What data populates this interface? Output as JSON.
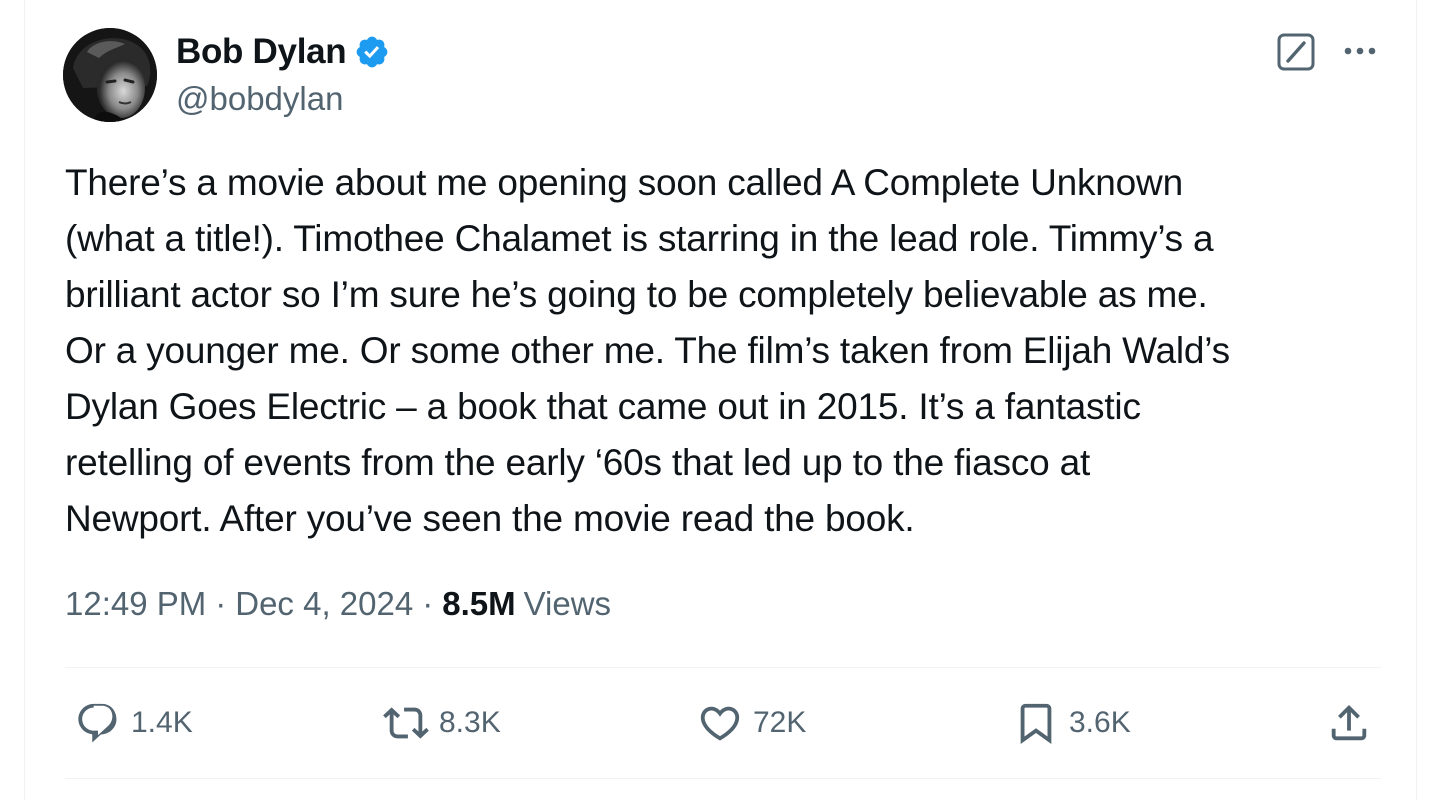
{
  "author": {
    "display_name": "Bob Dylan",
    "handle": "@bobdylan",
    "verified": true,
    "avatar_icon": "profile-photo"
  },
  "header_actions": {
    "grok_icon": "grok-icon",
    "more_icon": "more-horizontal-icon"
  },
  "tweet": {
    "text": "There’s a movie about me opening soon called A Complete Unknown\n(what a title!). Timothee Chalamet is starring in the lead role. Timmy’s a\nbrilliant actor so I’m sure he’s going to be completely believable as me.\nOr a younger me. Or some other me. The film’s taken from Elijah Wald’s\nDylan Goes Electric – a book that came out in 2015. It’s a fantastic\nretelling of events from the early ‘60s that led up to the fiasco at\nNewport. After you’ve seen the movie read the book."
  },
  "meta": {
    "time": "12:49 PM",
    "separator": "·",
    "date": "Dec 4, 2024",
    "views_count": "8.5M",
    "views_label": "Views"
  },
  "actions": {
    "reply": {
      "icon": "reply-icon",
      "count": "1.4K"
    },
    "repost": {
      "icon": "repost-icon",
      "count": "8.3K"
    },
    "like": {
      "icon": "heart-icon",
      "count": "72K"
    },
    "bookmark": {
      "icon": "bookmark-icon",
      "count": "3.6K"
    },
    "share": {
      "icon": "share-icon"
    }
  },
  "colors": {
    "primary_text": "#0f1419",
    "secondary_text": "#536471",
    "verified_badge": "#1d9bf0",
    "divider": "#eff3f4"
  }
}
